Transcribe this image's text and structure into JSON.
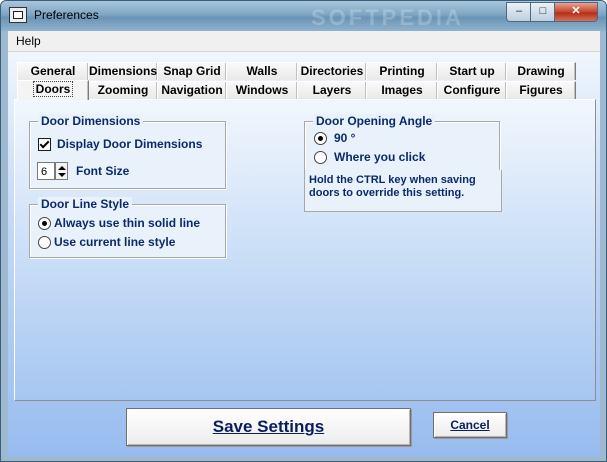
{
  "window": {
    "title": "Preferences",
    "watermark": "SOFTPEDIA"
  },
  "titlebar_buttons": {
    "minimize": "–",
    "maximize": "□",
    "close": "✕"
  },
  "menubar": {
    "items": [
      "Help"
    ]
  },
  "tabs": {
    "row_back": [
      "General",
      "Dimensions",
      "Snap Grid",
      "Walls",
      "Directories",
      "Printing",
      "Start up",
      "Drawing"
    ],
    "row_front": [
      "Doors",
      "Zooming",
      "Navigation",
      "Windows",
      "Layers",
      "Images",
      "Configure",
      "Figures"
    ],
    "active": "Doors"
  },
  "door_dimensions": {
    "title": "Door Dimensions",
    "display_label": "Display Door Dimensions",
    "display_checked": true,
    "font_size_value": "6",
    "font_size_label": "Font Size"
  },
  "door_line_style": {
    "title": "Door Line Style",
    "options": [
      "Always use thin solid line",
      "Use current line style"
    ],
    "selected_index": 0
  },
  "door_opening_angle": {
    "title": "Door Opening Angle",
    "options": [
      "90 °",
      "Where you click"
    ],
    "selected_index": 0,
    "hint_line1": "Hold the CTRL key when saving",
    "hint_line2": "doors to override this setting."
  },
  "buttons": {
    "save": "Save Settings",
    "cancel": "Cancel"
  }
}
